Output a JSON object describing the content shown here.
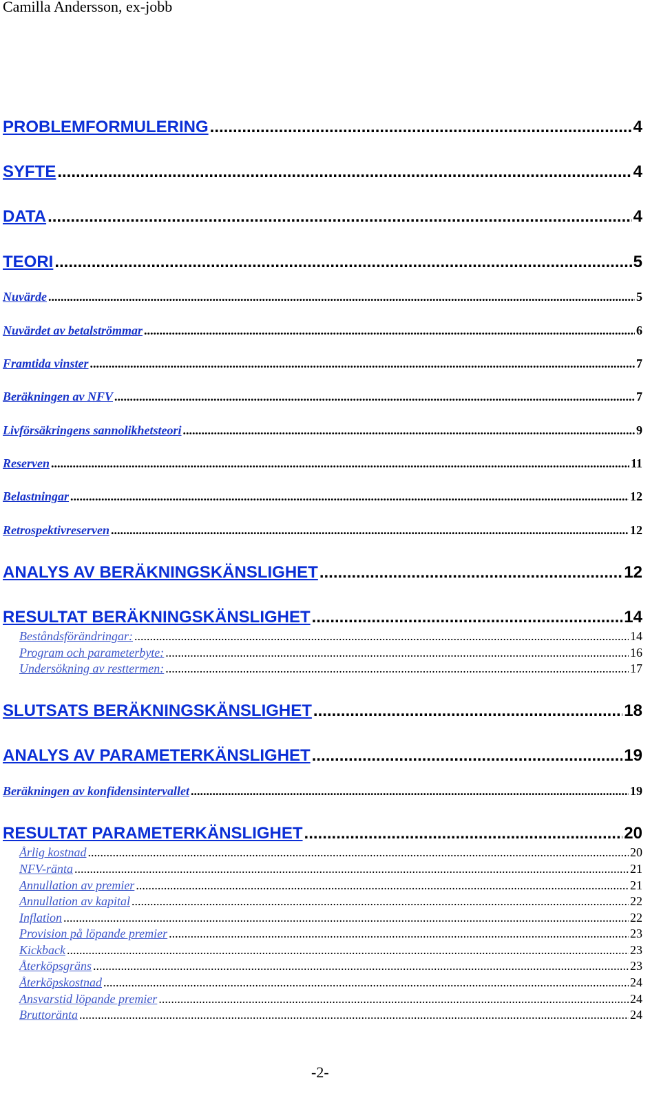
{
  "header": "Camilla Andersson, ex-jobb",
  "footer": "-2-",
  "link_color": "#0b2fd6",
  "toc": [
    {
      "label": "PROBLEMFORMULERING",
      "page": "4",
      "level": 1
    },
    {
      "label": "SYFTE",
      "page": "4",
      "level": 1
    },
    {
      "label": "DATA",
      "page": "4",
      "level": 1
    },
    {
      "label": "TEORI",
      "page": "5",
      "level": 1
    },
    {
      "label": "Nuvärde",
      "page": "5",
      "level": 2
    },
    {
      "label": "Nuvärdet av betalströmmar",
      "page": "6",
      "level": 2
    },
    {
      "label": "Framtida vinster",
      "page": "7",
      "level": 2
    },
    {
      "label": "Beräkningen av NFV",
      "page": "7",
      "level": 2
    },
    {
      "label": "Livförsäkringens sannolikhetsteori",
      "page": "9",
      "level": 2
    },
    {
      "label": "Reserven",
      "page": "11",
      "level": 2
    },
    {
      "label": "Belastningar",
      "page": "12",
      "level": 2
    },
    {
      "label": "Retrospektivreserven",
      "page": "12",
      "level": 2
    },
    {
      "label": "ANALYS AV BERÄKNINGSKÄNSLIGHET",
      "page": "12",
      "level": 1
    },
    {
      "label": "RESULTAT BERÄKNINGSKÄNSLIGHET",
      "page": "14",
      "level": 1
    },
    {
      "label": "Beståndsförändringar:",
      "page": "14",
      "level": 3
    },
    {
      "label": "Program och parameterbyte:",
      "page": "16",
      "level": 3
    },
    {
      "label": "Undersökning av resttermen:",
      "page": "17",
      "level": 3
    },
    {
      "label": "SLUTSATS BERÄKNINGSKÄNSLIGHET",
      "page": "18",
      "level": 1
    },
    {
      "label": "ANALYS AV PARAMETERKÄNSLIGHET",
      "page": "19",
      "level": 1
    },
    {
      "label": "Beräkningen av konfidensintervallet",
      "page": "19",
      "level": 2
    },
    {
      "label": "RESULTAT PARAMETERKÄNSLIGHET",
      "page": "20",
      "level": 1
    },
    {
      "label": "Årlig kostnad",
      "page": "20",
      "level": 3
    },
    {
      "label": "NFV-ränta",
      "page": "21",
      "level": 3
    },
    {
      "label": "Annullation av premier",
      "page": "21",
      "level": 3
    },
    {
      "label": "Annullation av kapital",
      "page": "22",
      "level": 3
    },
    {
      "label": "Inflation",
      "page": "22",
      "level": 3
    },
    {
      "label": "Provision på löpande premier",
      "page": "23",
      "level": 3
    },
    {
      "label": "Kickback",
      "page": "23",
      "level": 3
    },
    {
      "label": "Återköpsgräns",
      "page": "23",
      "level": 3
    },
    {
      "label": "Återköpskostnad",
      "page": "24",
      "level": 3
    },
    {
      "label": "Ansvarstid löpande premier",
      "page": "24",
      "level": 3
    },
    {
      "label": "Bruttoränta",
      "page": "24",
      "level": 3
    }
  ]
}
